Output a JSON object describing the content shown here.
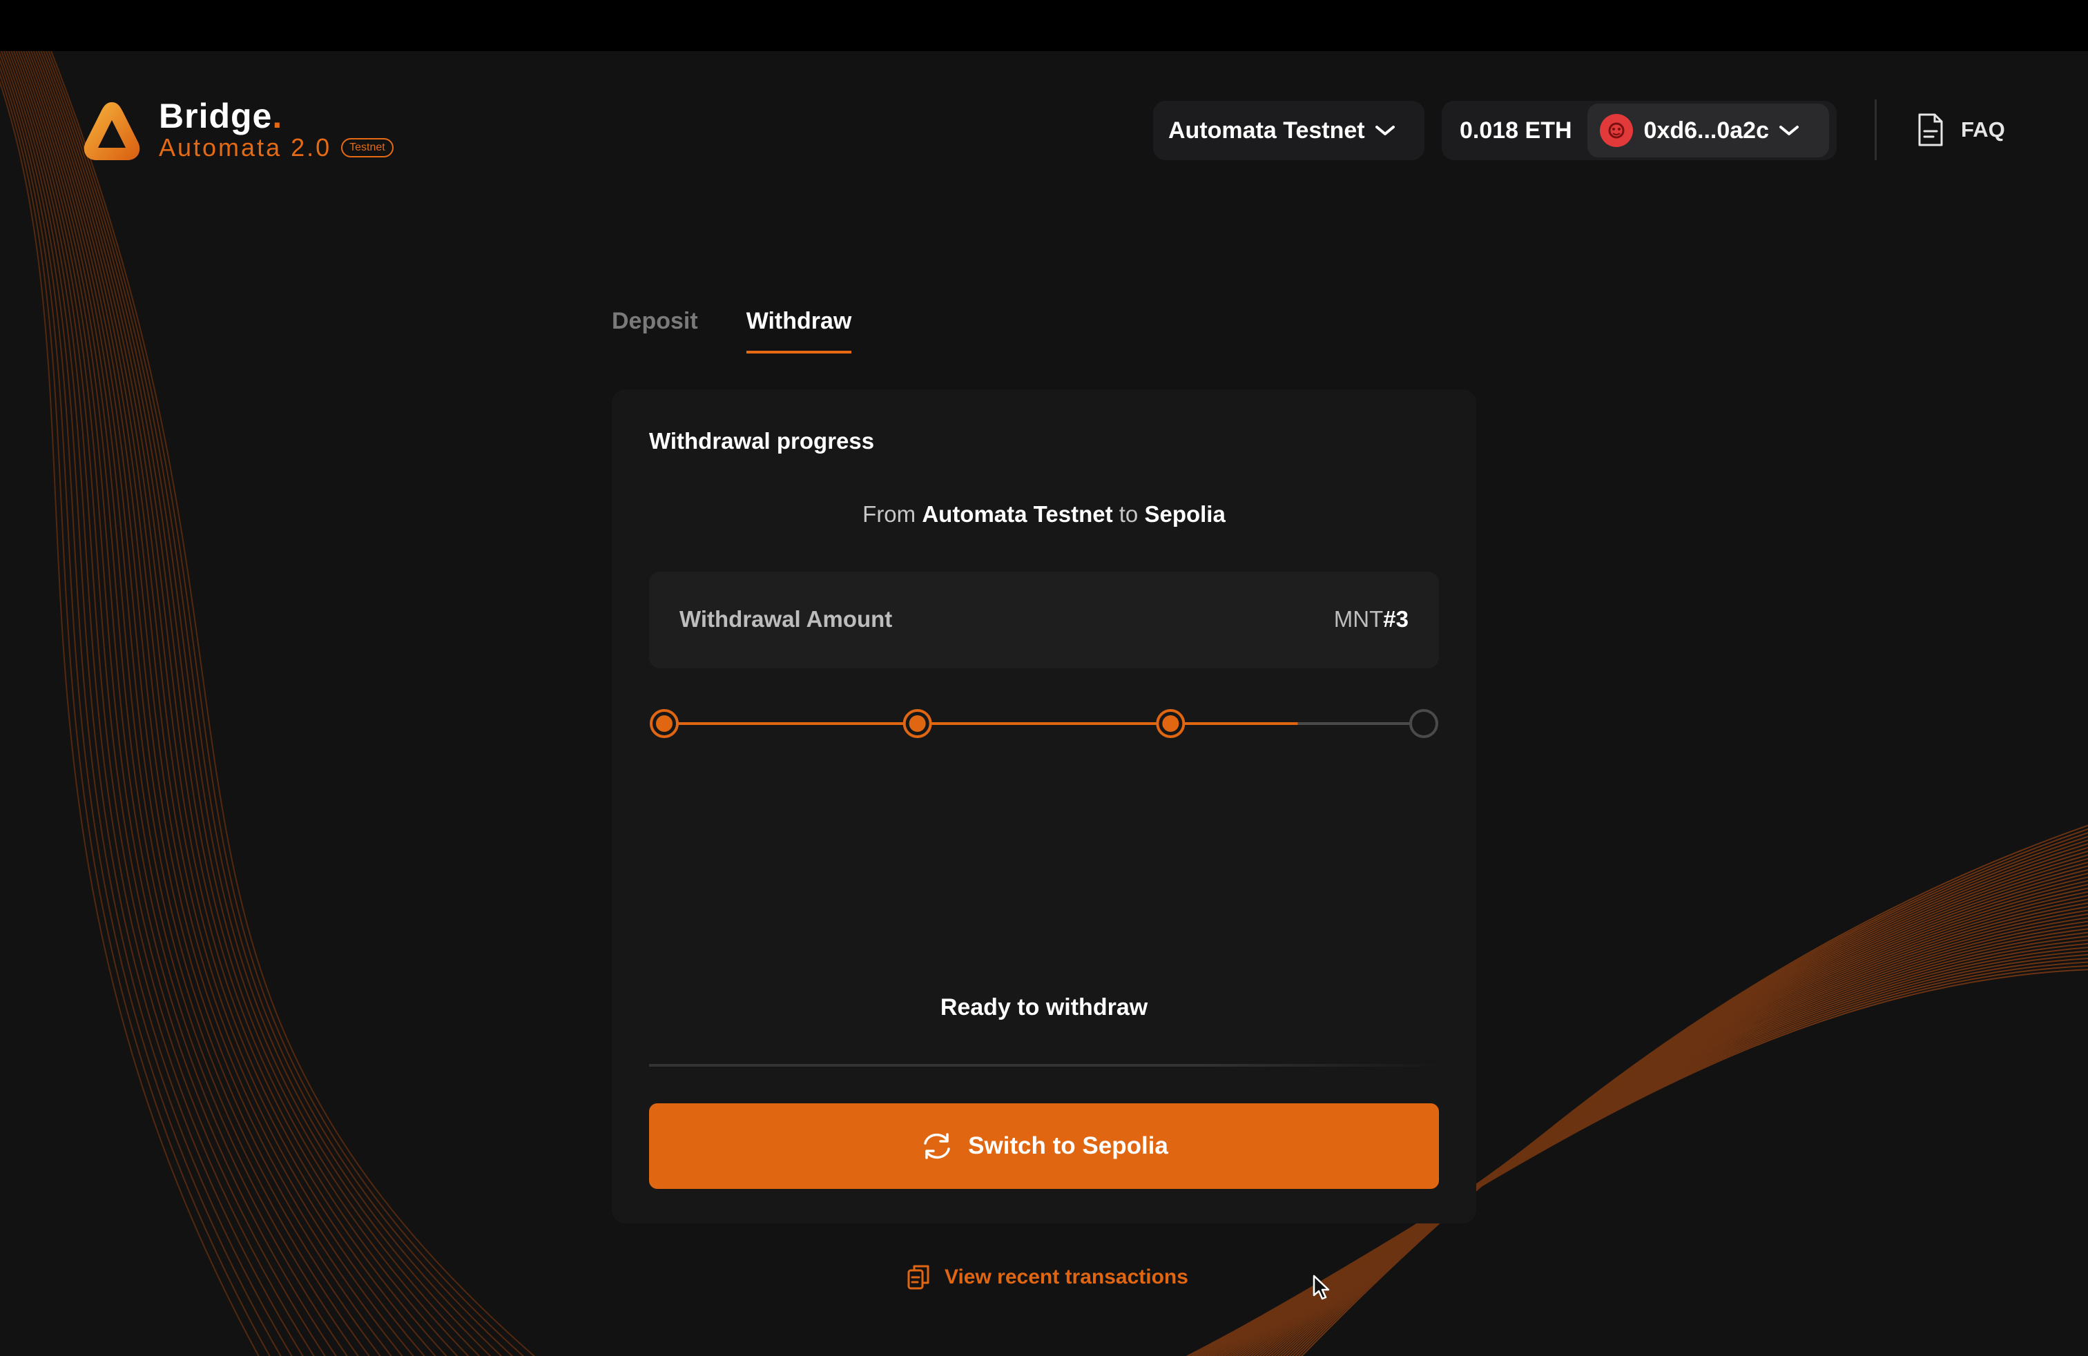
{
  "header": {
    "logo": {
      "title": "Bridge",
      "title_dot": ".",
      "subtitle": "Automata 2.0",
      "badge": "Testnet",
      "icon": "automata-logo-icon"
    },
    "network_selector": {
      "label": "Automata Testnet",
      "icon": "chevron-down-icon"
    },
    "wallet": {
      "balance": "0.018 ETH",
      "address": "0xd6...0a2c",
      "avatar_icon": "wallet-avatar-icon",
      "dropdown_icon": "chevron-down-icon"
    },
    "faq": {
      "label": "FAQ",
      "icon": "document-icon"
    }
  },
  "tabs": [
    {
      "label": "Deposit",
      "active": false
    },
    {
      "label": "Withdraw",
      "active": true
    }
  ],
  "card": {
    "title": "Withdrawal progress",
    "route": {
      "from_word": "From",
      "from": "Automata Testnet",
      "to_word": "to",
      "to": "Sepolia"
    },
    "amount": {
      "label": "Withdrawal Amount",
      "unit": "MNT",
      "value": "#3"
    },
    "progress": {
      "steps_total": 4,
      "steps_completed": 3,
      "fill_fraction": 0.834
    },
    "status": "Ready to withdraw",
    "action_button": {
      "label": "Switch to Sepolia",
      "icon": "switch-network-icon"
    }
  },
  "footer_link": {
    "label": "View recent transactions",
    "icon": "clipboard-icon"
  },
  "colors": {
    "accent": "#e06612",
    "background": "#121212",
    "card": "#171717",
    "inactive_step": "#4a4a4a"
  }
}
